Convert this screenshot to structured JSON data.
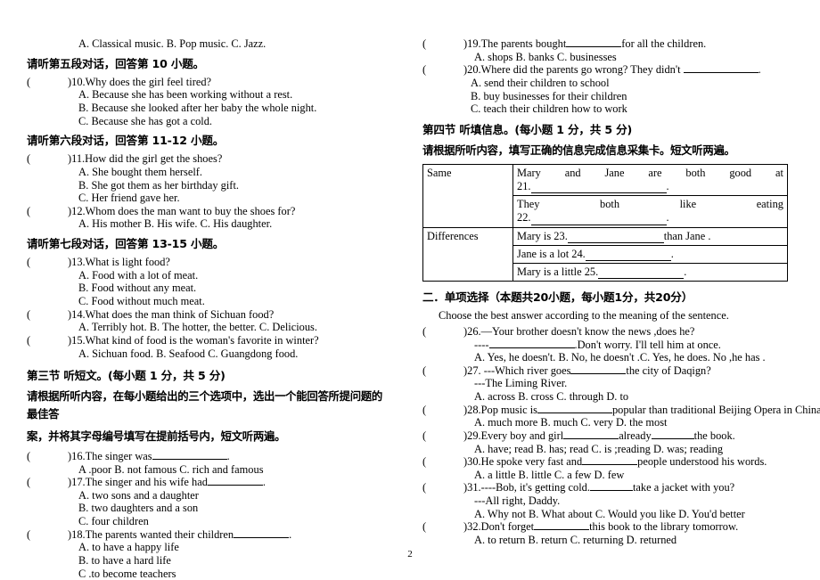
{
  "page": {
    "number": "2"
  },
  "left_column": {
    "first_options_line": "A. Classical music.   B. Pop music.   C. Jazz.",
    "heading_dialog5": "请听第五段对话，回答第 10 小题。",
    "q10": {
      "paren": "(",
      "stem": ")10.Why does the girl feel tired?",
      "options": [
        "A. Because she has been working without a rest.",
        "B. Because she looked after her baby the whole night.",
        "C. Because she has got a cold."
      ]
    },
    "heading_dialog6": "请听第六段对话，回答第 11-12 小题。",
    "q11": {
      "paren": "(",
      "stem": ")11.How did the girl get the shoes?",
      "options": [
        "A. She bought them herself.",
        "B. She got them as her birthday gift.",
        "C. Her friend gave her."
      ]
    },
    "q12": {
      "paren": "(",
      "stem": ")12.Whom does the man want to buy the shoes for?",
      "options": [
        "A. His mother    B. His wife.    C. His daughter."
      ]
    },
    "heading_dialog7": "请听第七段对话，回答第 13-15 小题。",
    "q13": {
      "paren": "(",
      "stem": ")13.What is light food?",
      "options": [
        "A. Food with a lot of meat.",
        "B. Food without any meat.",
        "C. Food without much meat."
      ]
    },
    "q14": {
      "paren": "(",
      "stem": ")14.What does the man think of Sichuan food?",
      "options": [
        "A. Terribly hot.    B. The hotter, the better.   C. Delicious."
      ]
    },
    "q15": {
      "paren": "(",
      "stem": ")15.What kind of food is the woman's favorite in winter?",
      "options": [
        "A. Sichuan food.   B. Seafood     C. Guangdong food."
      ]
    },
    "section3_heading": "第三节 听短文。(每小题 1 分，共 5 分)",
    "section3_instructions_line1": "请根据所听内容，在每小题给出的三个选项中，选出一个能回答所提问题的最佳答",
    "section3_instructions_line2": "案，并将其字母编号填写在提前括号内，短文听两遍。",
    "q16": {
      "paren": "(",
      "stem_before": ")16.The singer was",
      "stem_after": ".",
      "options": [
        "A .poor     B. not famous    C. rich and    famous"
      ]
    },
    "q17": {
      "paren": "(",
      "stem_before": ")17.The singer and his wife had",
      "stem_after": ".",
      "options": [
        "A. two sons and a daughter",
        "B. two daughters and a son",
        "C. four children"
      ]
    },
    "q18": {
      "paren": "(",
      "stem_before": ")18.The parents wanted their children",
      "stem_after": ".",
      "options": [
        "A. to have a happy life",
        "B. to have a hard life",
        "C .to become teachers"
      ]
    }
  },
  "right_column": {
    "q19": {
      "paren": "(",
      "stem_before": ")19.The parents bought",
      "stem_after": "for all the children.",
      "options": [
        "A. shops     B. banks   C. businesses"
      ]
    },
    "q20": {
      "paren": "(",
      "stem_before": ")20.Where did the parents go wrong? They didn't",
      "stem_after": ".",
      "options": [
        "A. send their children to school",
        "B. buy businesses for their children",
        "C. teach their children how to work"
      ]
    },
    "section4_heading": "第四节 听填信息。(每小题 1 分，共 5 分)",
    "section4_instructions": "请根据所听内容，填写正确的信息完成信息采集卡。短文听两遍。",
    "info_card": {
      "rows": [
        {
          "label": "Same",
          "lines": [
            {
              "words": [
                "Mary",
                "and",
                "Jane",
                "are",
                "both",
                "good",
                "at"
              ],
              "blank_number": "21.",
              "tail": "."
            },
            {
              "words": [
                "They",
                "both",
                "like",
                "eating"
              ],
              "blank_number": "22.",
              "tail": "."
            }
          ]
        },
        {
          "label": "Differences",
          "lines": [
            {
              "text_before": "Mary is 23.",
              "text_after": "than Jane ."
            },
            {
              "text_before": "Jane is a lot 24.",
              "text_after": "."
            },
            {
              "text_before": "Mary is a little 25.",
              "text_after": "."
            }
          ]
        }
      ]
    },
    "section2_heading": "二．单项选择（本题共20小题，每小题1分，共20分）",
    "section2_instructions": "Choose the best answer according to the meaning of the sentence.",
    "q26": {
      "paren": "(",
      "stem": ")26.—Your brother doesn't know the news ,does he?",
      "reply_before": "----",
      "reply_after": ".Don't worry. I'll tell him at once.",
      "options": [
        "A. Yes, he doesn't. B. No, he doesn't .C. Yes, he does. No ,he has ."
      ]
    },
    "q27": {
      "paren": "(",
      "stem_before": ")27. ---Which river goes",
      "stem_after": "the city of Daqign?",
      "reply": "---The Liming River.",
      "options": [
        "A. across     B. cross     C. through     D. to"
      ]
    },
    "q28": {
      "paren": "(",
      "stem_before": ")28.Pop music is",
      "stem_after": "popular than traditional Beijing Opera in China.",
      "options": [
        "A. much more     B. much    C. very    D. the most"
      ]
    },
    "q29": {
      "paren": "(",
      "stem_before": ")29.Every boy and girl",
      "stem_mid": "already",
      "stem_after": "the book.",
      "options": [
        "A. have; read   B. has; read   C. is ;reading   D. was; reading"
      ]
    },
    "q30": {
      "paren": "(",
      "stem_before": ")30.He spoke very fast and",
      "stem_after": "people understood his words.",
      "options": [
        "A. a little     B. little    C. a few     D. few"
      ]
    },
    "q31": {
      "paren": "(",
      "stem_before": ")31.----Bob, it's   getting cold.",
      "stem_after": "take a jacket with you?",
      "reply": "---All right, Daddy.",
      "options": [
        "A. Why not     B. What about    C. Would you like    D. You'd better"
      ]
    },
    "q32": {
      "paren": "(",
      "stem_before": ")32.Don't forget",
      "stem_after": "this book to the library tomorrow.",
      "options": [
        "A. to return    B. return    C. returning    D. returned"
      ]
    }
  }
}
